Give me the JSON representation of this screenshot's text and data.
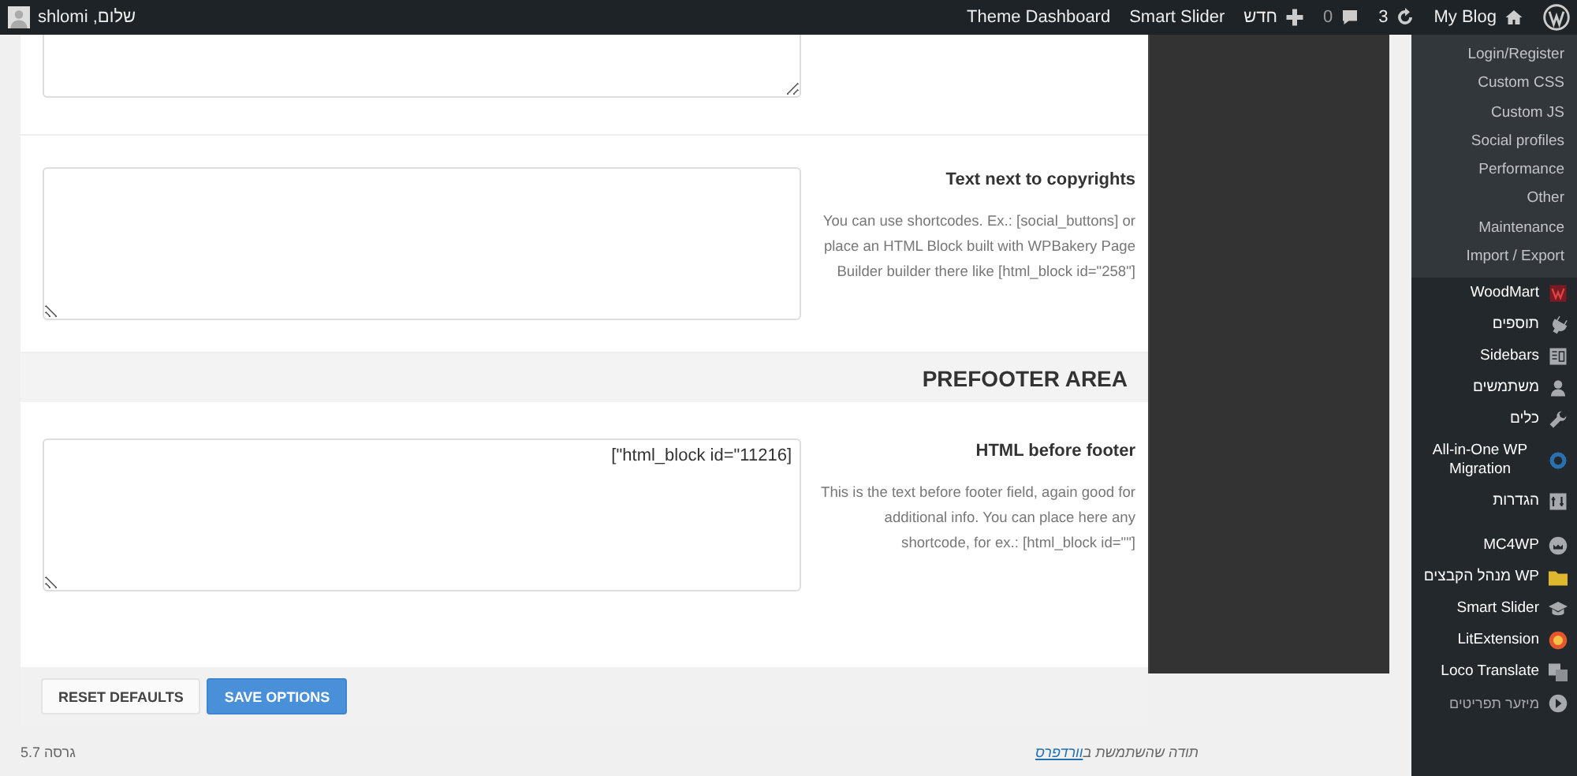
{
  "admin_bar": {
    "greeting": "שלום, shlomi",
    "items": [
      {
        "kind": "text",
        "label": "Theme Dashboard"
      },
      {
        "kind": "text",
        "label": "Smart Slider"
      },
      {
        "kind": "new",
        "label": "חדש"
      },
      {
        "kind": "comments",
        "label": "0"
      },
      {
        "kind": "updates",
        "label": "3"
      },
      {
        "kind": "home",
        "label": "My Blog"
      },
      {
        "kind": "wp"
      }
    ]
  },
  "options": {
    "rows": [
      {
        "kind": "field_top"
      },
      {
        "kind": "field",
        "title": "Text next to copyrights",
        "description": "You can use shortcodes. Ex.: [social_buttons] or place an HTML Block built with WPBakery Page Builder builder there like [html_block id=\"258\"]"
      },
      {
        "kind": "section",
        "title": "PREFOOTER AREA"
      },
      {
        "kind": "field",
        "title": "HTML before footer",
        "description": "This is the text before footer field, again good for additional info. You can place here any shortcode, for ex.: [html_block id=\"\"]",
        "value": "[html_block id=\"11216\"]"
      }
    ],
    "buttons": [
      {
        "label": "RESET DEFAULTS",
        "primary": false
      },
      {
        "label": "SAVE OPTIONS",
        "primary": true
      }
    ]
  },
  "sidebar": {
    "submenu": [
      "Login/Register",
      "Custom CSS",
      "Custom JS",
      "Social profiles",
      "Performance",
      "Other",
      "Maintenance",
      "Import / Export"
    ],
    "menu": [
      {
        "label": "WoodMart",
        "kind": "woodmart"
      },
      {
        "label": "תוספים",
        "kind": "plugins"
      },
      {
        "label": "Sidebars",
        "kind": "grid"
      },
      {
        "label": "משתמשים",
        "kind": "users"
      },
      {
        "label": "כלים",
        "kind": "tools"
      },
      {
        "label": "All-in-One WP Migration",
        "kind": "migration"
      },
      {
        "label": "הגדרות",
        "kind": "settings"
      },
      {
        "label": "MC4WP",
        "kind": "mc4wp"
      },
      {
        "label": "WP מנהל הקבצים",
        "kind": "folder"
      },
      {
        "label": "Smart Slider",
        "kind": "cap"
      },
      {
        "label": "LitExtension",
        "kind": "lit"
      },
      {
        "label": "Loco Translate",
        "kind": "translate"
      },
      {
        "label": "מיזער תפריטים",
        "kind": "collapse"
      }
    ]
  },
  "footer": {
    "thanks": "תודה שהשתמשת ב",
    "link": "וורדפרס",
    "version": "גרסה 5.7"
  }
}
